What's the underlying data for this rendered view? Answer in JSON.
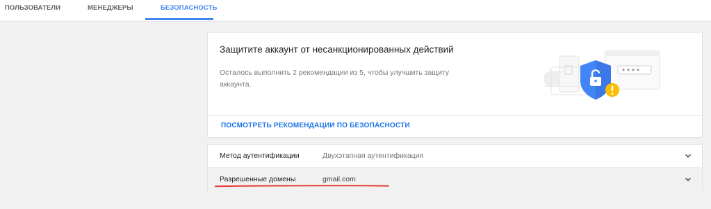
{
  "tabs": [
    {
      "label": "ПОЛЬЗОВАТЕЛИ"
    },
    {
      "label": "МЕНЕДЖЕРЫ"
    },
    {
      "label": "БЕЗОПАСНОСТЬ"
    }
  ],
  "security_card": {
    "title": "Защитите аккаунт от несанкционированных действий",
    "description": "Осталось выполнить 2 рекомендации из 5, чтобы улучшить защиту аккаунта.",
    "link": "ПОСМОТРЕТЬ РЕКОМЕНДАЦИИ ПО БЕЗОПАСНОСТИ",
    "illustration_icon": "shield-lock-warning-icon"
  },
  "settings": [
    {
      "label": "Метод аутентификации",
      "value": "Двухэтапная аутентификация"
    },
    {
      "label": "Разрешенные домены",
      "value": "gmail.com"
    }
  ],
  "colors": {
    "accent": "#4285f4",
    "link": "#1a73e8",
    "warning": "#fbbc04",
    "annotation": "#e53935"
  }
}
